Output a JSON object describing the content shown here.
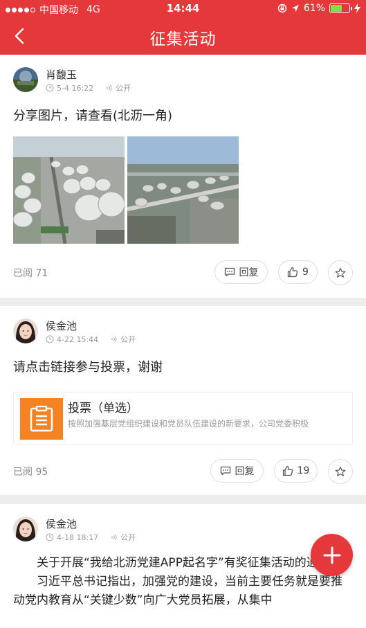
{
  "status": {
    "carrier": "中国移动",
    "network": "4G",
    "time": "14:44",
    "battery": "61%",
    "battery_level": 0.61
  },
  "nav": {
    "title": "征集活动",
    "back_icon": "chevron-left-icon"
  },
  "posts": [
    {
      "author": "肖馥玉",
      "date": "5-4 16:22",
      "visibility": "公开",
      "text": "分享图片，请查看(北沥一角)",
      "reads": "已阅 71",
      "reply_label": "回复",
      "likes": "9"
    },
    {
      "author": "侯金池",
      "date": "4-22 15:44",
      "visibility": "公开",
      "text": "请点击链接参与投票，谢谢",
      "vote_title": "投票（单选）",
      "vote_desc": "按照加强基层党组织建设和党员队伍建设的新要求，公司党委积极",
      "reads": "已阅 95",
      "reply_label": "回复",
      "likes": "19"
    },
    {
      "author": "侯金池",
      "date": "4-18 18:17",
      "visibility": "公开",
      "para1": "关于开展“我给北沥党建APP起名字”有奖征集活动的通知",
      "para2": "习近平总书记指出，加强党的建设，当前主要任务就是要推动党内教育从“关键少数”向广大党员拓展，从集中"
    }
  ],
  "colors": {
    "brand": "#e5383b",
    "vote_icon_bg": "#f58223"
  }
}
